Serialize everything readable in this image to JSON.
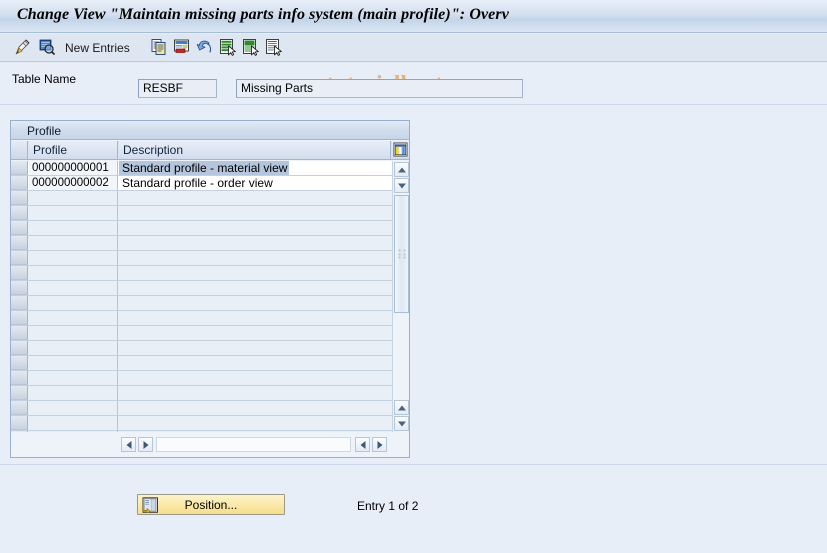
{
  "window": {
    "title": "Change View \"Maintain missing parts info system (main profile)\": Overv"
  },
  "watermark": {
    "text": "www.tutorialkart.com",
    "color": "#e3b384"
  },
  "toolbar": {
    "new_entries_label": "New Entries",
    "buttons": [
      {
        "name": "display-change-icon",
        "title": "Display/Change"
      },
      {
        "name": "details-icon",
        "title": "Details"
      },
      {
        "name": "copy-icon",
        "title": "Copy As..."
      },
      {
        "name": "delete-icon",
        "title": "Delete"
      },
      {
        "name": "undo-icon",
        "title": "Undo Change"
      },
      {
        "name": "select-all-icon",
        "title": "Select All"
      },
      {
        "name": "select-block-icon",
        "title": "Select Block"
      },
      {
        "name": "deselect-all-icon",
        "title": "Deselect All"
      }
    ]
  },
  "fields": {
    "table_name_label": "Table Name",
    "table_name_value": "RESBF",
    "table_description_value": "Missing Parts"
  },
  "table": {
    "group_title": "Profile",
    "columns": [
      {
        "key": "profile",
        "header": "Profile"
      },
      {
        "key": "description",
        "header": "Description"
      }
    ],
    "settings_icon": "table-settings-icon",
    "rows": [
      {
        "profile": "000000000001",
        "description": "Standard profile - material view",
        "selected": true
      },
      {
        "profile": "000000000002",
        "description": "Standard profile - order view",
        "selected": false
      }
    ],
    "empty_row_count": 17
  },
  "footer": {
    "position_button_label": "Position...",
    "entry_count_text": "Entry 1 of 2"
  },
  "colors": {
    "page_background": "#e8eef7",
    "title_bar": "#cfdcec",
    "toolbar": "#dde6f1",
    "table_border": "#97b0cd",
    "selection_highlight": "#b4c5dd",
    "button_yellow": "#fae9a8"
  }
}
